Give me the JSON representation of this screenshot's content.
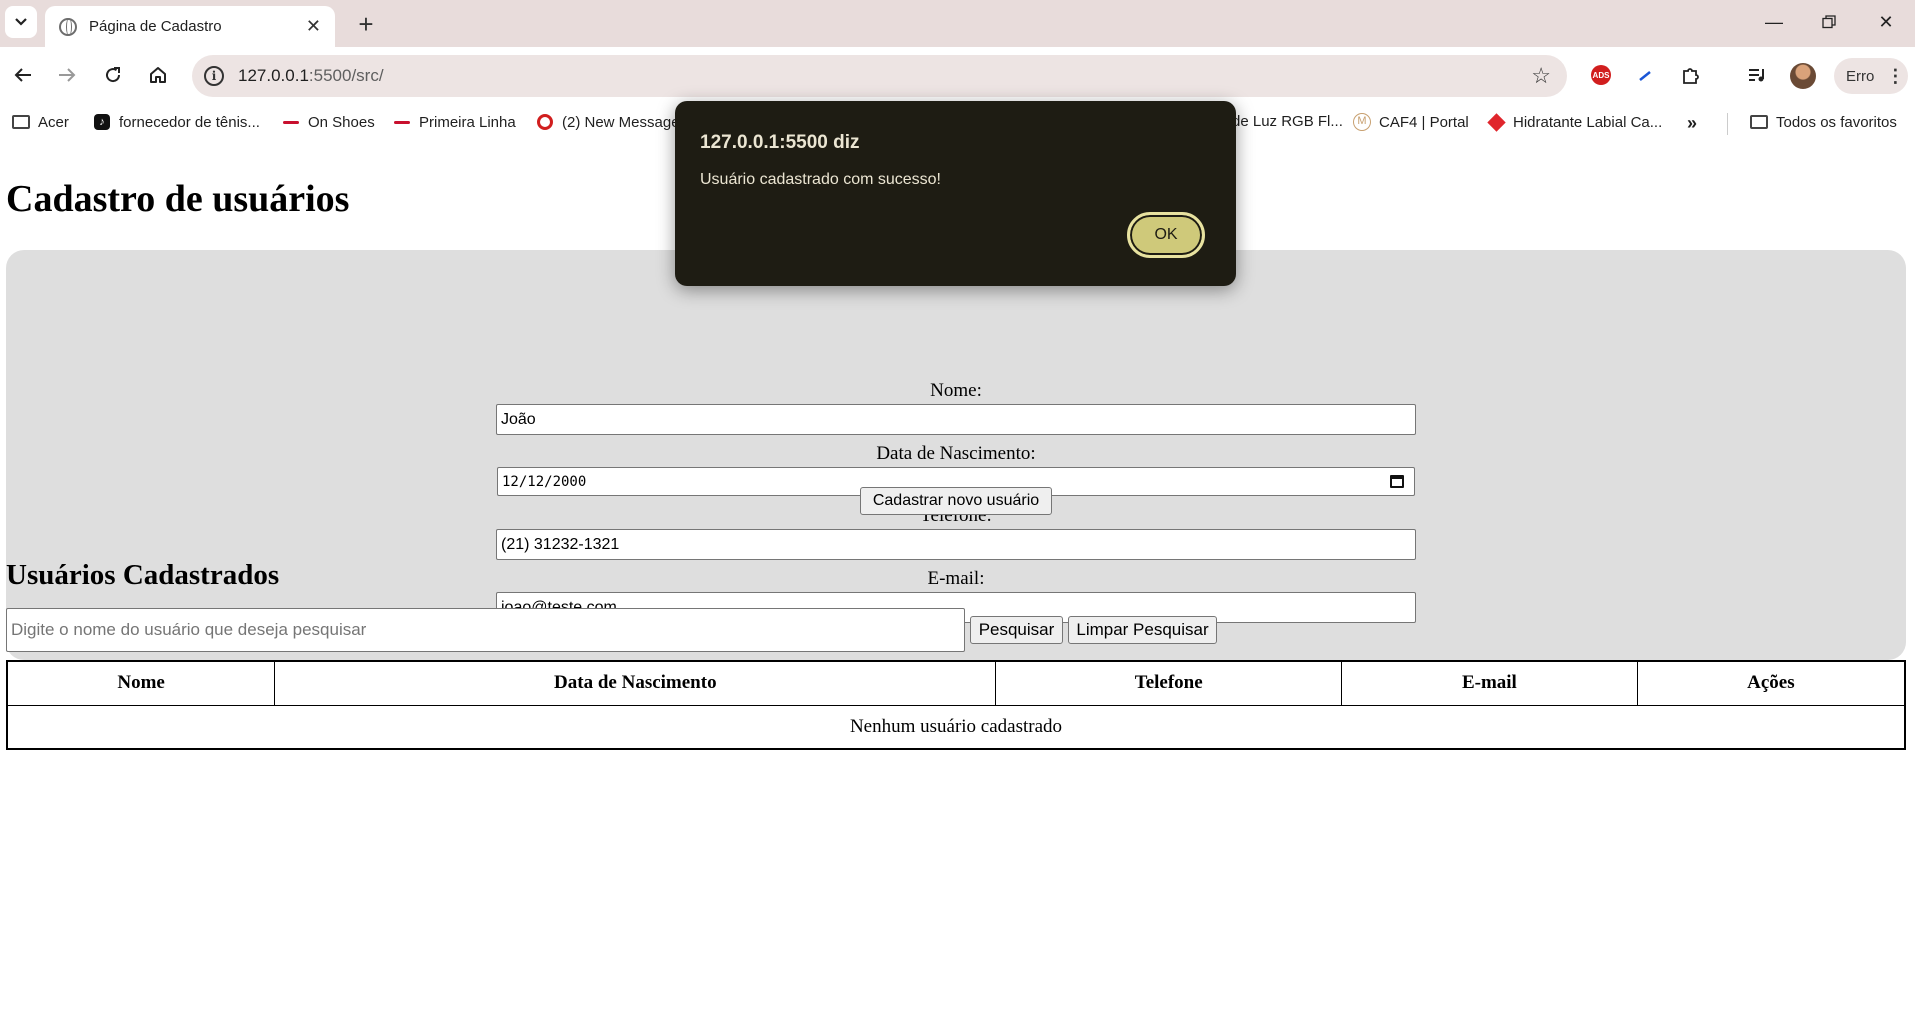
{
  "browser": {
    "tab_title": "Página de Cadastro",
    "url_host": "127.0.0.1",
    "url_path": ":5500/src/",
    "profile_label": "Erro",
    "bookmarks": [
      {
        "label": "Acer",
        "icon": "folder-icon"
      },
      {
        "label": "fornecedor de tênis...",
        "icon": "tiktok-icon"
      },
      {
        "label": "On Shoes",
        "icon": "dash-icon"
      },
      {
        "label": "Primeira Linha",
        "icon": "dash-icon"
      },
      {
        "label": "(2) New Message",
        "icon": "circle-icon"
      },
      {
        "label": "de Luz RGB Fl...",
        "icon": "none"
      },
      {
        "label": "CAF4 | Portal",
        "icon": "m-icon"
      },
      {
        "label": "Hidratante Labial Ca...",
        "icon": "diamond-icon"
      },
      {
        "label": "Todos os favoritos",
        "icon": "folder-icon"
      }
    ]
  },
  "page": {
    "title": "Cadastro de usuários",
    "form": {
      "name_label": "Nome:",
      "name_value": "João",
      "birth_label": "Data de Nascimento:",
      "birth_value": "12/12/2000",
      "phone_label": "Telefone:",
      "phone_value": "(21) 31232-1321",
      "email_label": "E-mail:",
      "email_value": "joao@teste.com",
      "submit_label": "Cadastrar novo usuário"
    },
    "list": {
      "title": "Usuários Cadastrados",
      "search_placeholder": "Digite o nome do usuário que deseja pesquisar",
      "search_button": "Pesquisar",
      "clear_button": "Limpar Pesquisar",
      "columns": [
        "Nome",
        "Data de Nascimento",
        "Telefone",
        "E-mail",
        "Ações"
      ],
      "empty_message": "Nenhum usuário cadastrado"
    }
  },
  "dialog": {
    "title": "127.0.0.1:5500 diz",
    "message": "Usuário cadastrado com sucesso!",
    "ok_label": "OK"
  },
  "colors": {
    "form_panel": "#dedede",
    "dialog_bg": "#1e1c13",
    "dialog_button": "#cfc97a"
  }
}
